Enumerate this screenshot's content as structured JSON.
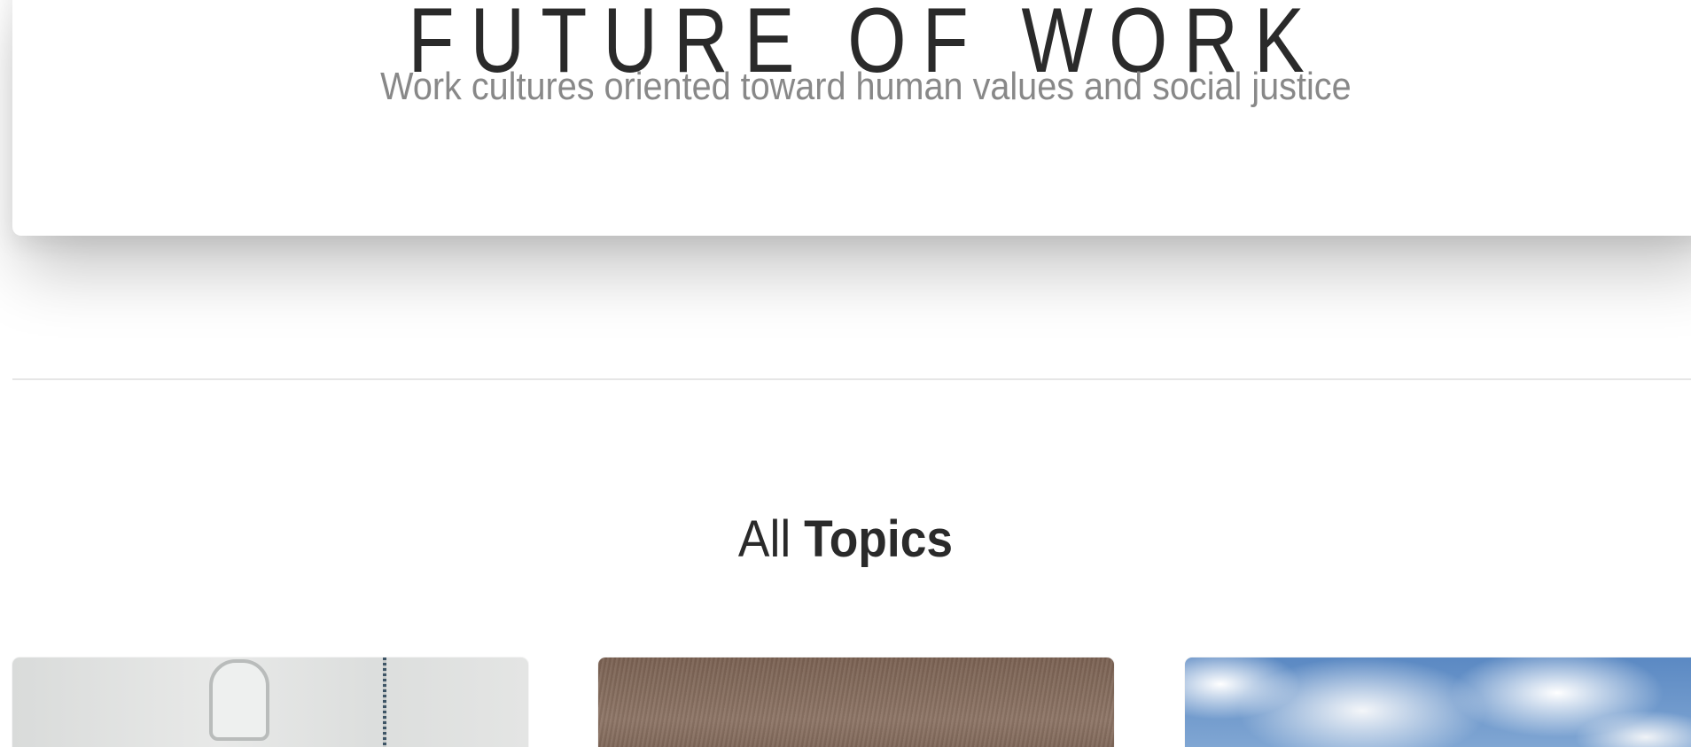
{
  "hero": {
    "title": "FUTURE OF WORK",
    "subtitle": "Work cultures oriented toward human values and social justice"
  },
  "topics_section": {
    "heading_light": "All",
    "heading_bold": "Topics"
  },
  "topic_cards": [
    {
      "image": "white-office-equipment-photo"
    },
    {
      "image": "wood-grain-photo"
    },
    {
      "image": "blue-sky-clouds-photo"
    }
  ],
  "colors": {
    "title": "#2a2a2a",
    "subtitle": "#888888",
    "divider": "#e6e6e6",
    "background": "#ffffff"
  }
}
